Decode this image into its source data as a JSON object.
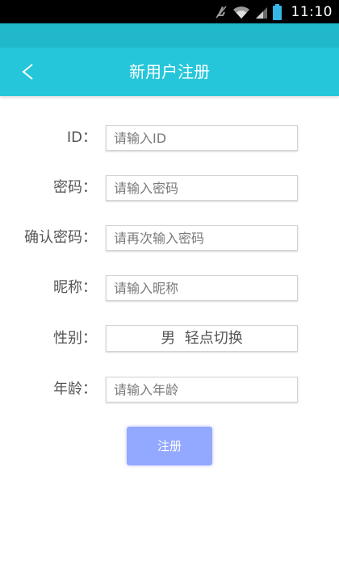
{
  "status_bar": {
    "time": "11:10",
    "icons": [
      "mute-icon",
      "wifi-icon",
      "signal-icon",
      "battery-icon"
    ]
  },
  "toolbar": {
    "back_symbol": "<",
    "title": "新用户注册",
    "color": "#25c6d9"
  },
  "form": {
    "id": {
      "label": "ID：",
      "placeholder": "请输入ID",
      "value": ""
    },
    "password": {
      "label": "密码：",
      "placeholder": "请输入密码",
      "value": ""
    },
    "confirm_password": {
      "label": "确认密码：",
      "placeholder": "请再次输入密码",
      "value": ""
    },
    "nickname": {
      "label": "昵称：",
      "placeholder": "请输入昵称",
      "value": ""
    },
    "gender": {
      "label": "性别：",
      "value": "男  轻点切换"
    },
    "age": {
      "label": "年龄：",
      "placeholder": "请输入年龄",
      "value": ""
    }
  },
  "submit": {
    "label": "注册",
    "color": "#93a8ff"
  }
}
